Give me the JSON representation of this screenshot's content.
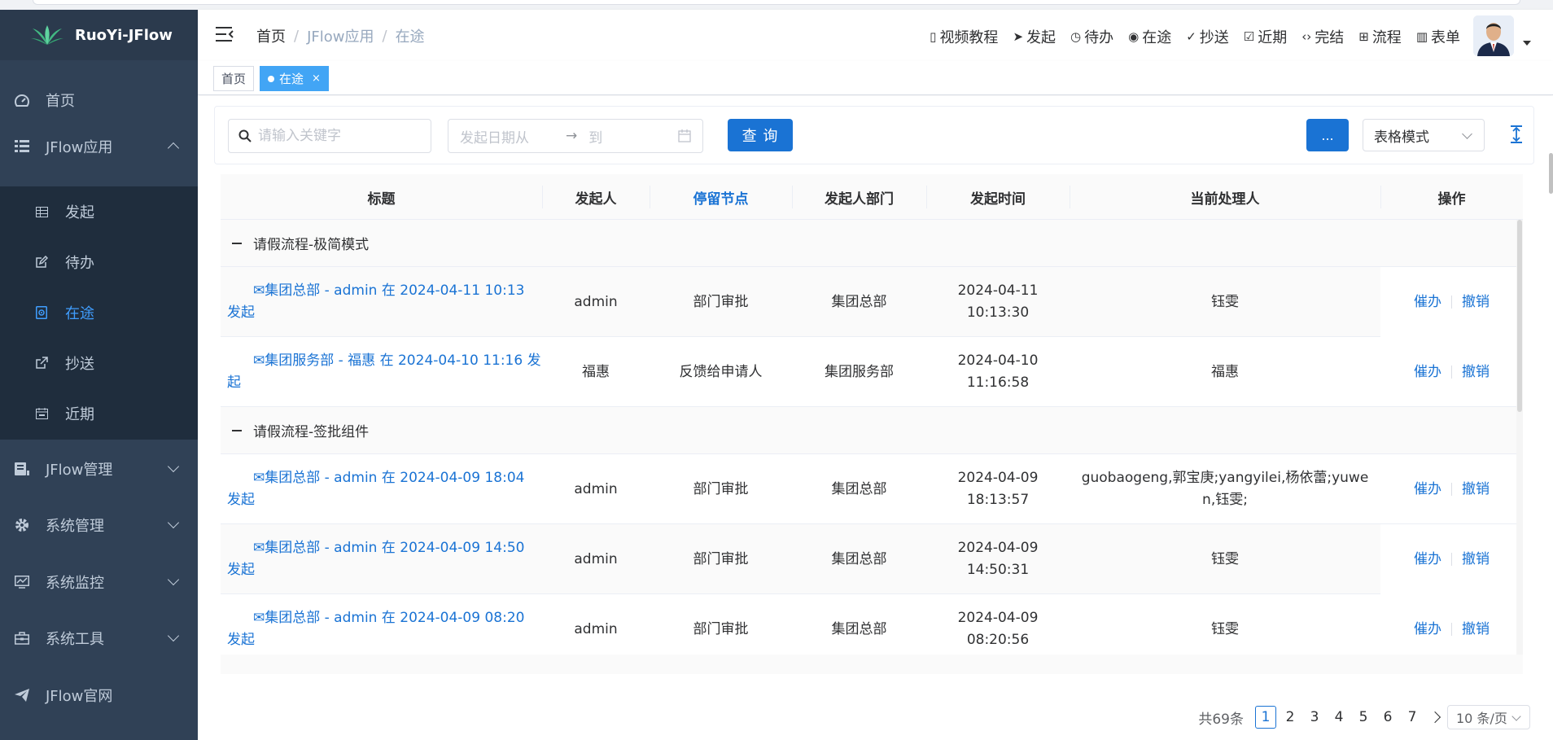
{
  "app": {
    "title": "RuoYi-JFlow"
  },
  "sidebar": {
    "items": [
      {
        "label": "首页",
        "icon": "dashboard-icon"
      },
      {
        "label": "JFlow应用",
        "icon": "tree-table-icon",
        "expanded": true
      },
      {
        "label": "JFlow管理",
        "icon": "monitor-icon"
      },
      {
        "label": "系统管理",
        "icon": "gear-icon"
      },
      {
        "label": "系统监控",
        "icon": "chart-icon"
      },
      {
        "label": "系统工具",
        "icon": "toolbox-icon"
      },
      {
        "label": "JFlow官网",
        "icon": "send-icon"
      }
    ],
    "submenu": [
      {
        "label": "发起",
        "icon": "grid-icon"
      },
      {
        "label": "待办",
        "icon": "edit-icon"
      },
      {
        "label": "在途",
        "icon": "target-icon",
        "active": true
      },
      {
        "label": "抄送",
        "icon": "external-link-icon"
      },
      {
        "label": "近期",
        "icon": "calendar-icon"
      }
    ]
  },
  "header": {
    "breadcrumb": [
      "首页",
      "JFlow应用",
      "在途"
    ],
    "nav": [
      {
        "label": "视频教程",
        "icon": "mobile-icon"
      },
      {
        "label": "发起",
        "icon": "send-icon"
      },
      {
        "label": "待办",
        "icon": "clock-icon"
      },
      {
        "label": "在途",
        "icon": "target-icon"
      },
      {
        "label": "抄送",
        "icon": "check-circle-icon"
      },
      {
        "label": "近期",
        "icon": "check-square-icon"
      },
      {
        "label": "完结",
        "icon": "code-icon"
      },
      {
        "label": "流程",
        "icon": "sitemap-icon"
      },
      {
        "label": "表单",
        "icon": "book-icon"
      }
    ]
  },
  "tags": [
    {
      "label": "首页",
      "active": false
    },
    {
      "label": "在途",
      "active": true,
      "close": "×"
    }
  ],
  "toolbar": {
    "search_placeholder": "请输入关键字",
    "date_from_placeholder": "发起日期从",
    "date_arrow": "→",
    "date_to_placeholder": "到",
    "query_label": "查 询",
    "more_label": "...",
    "mode_value": "表格模式"
  },
  "table": {
    "columns": [
      "标题",
      "发起人",
      "停留节点",
      "发起人部门",
      "发起时间",
      "当前处理人",
      "操作"
    ],
    "groups": [
      {
        "name": "请假流程-极简模式",
        "rows": [
          {
            "title": "✉集团总部 - admin 在 2024-04-11 10:13 发起",
            "starter": "admin",
            "node": "部门审批",
            "dept": "集团总部",
            "time_date": "2024-04-11",
            "time_clock": "10:13:30",
            "handler": "钰雯"
          },
          {
            "title": "✉集团服务部 - 福惠 在 2024-04-10 11:16 发起",
            "starter": "福惠",
            "node": "反馈给申请人",
            "dept": "集团服务部",
            "time_date": "2024-04-10",
            "time_clock": "11:16:58",
            "handler": "福惠"
          }
        ]
      },
      {
        "name": "请假流程-签批组件",
        "rows": [
          {
            "title": "✉集团总部 - admin 在 2024-04-09 18:04 发起",
            "starter": "admin",
            "node": "部门审批",
            "dept": "集团总部",
            "time_date": "2024-04-09",
            "time_clock": "18:13:57",
            "handler": "guobaogeng,郭宝庚;yangyilei,杨依蕾;yuwen,钰雯;"
          },
          {
            "title": "✉集团总部 - admin 在 2024-04-09 14:50 发起",
            "starter": "admin",
            "node": "部门审批",
            "dept": "集团总部",
            "time_date": "2024-04-09",
            "time_clock": "14:50:31",
            "handler": "钰雯"
          },
          {
            "title": "✉集团总部 - admin 在 2024-04-09 08:20 发起",
            "starter": "admin",
            "node": "部门审批",
            "dept": "集团总部",
            "time_date": "2024-04-09",
            "time_clock": "08:20:56",
            "handler": "钰雯"
          }
        ]
      }
    ],
    "actions": {
      "urge": "催办",
      "revoke": "撤销"
    }
  },
  "pagination": {
    "total": "共69条",
    "pages": [
      "1",
      "2",
      "3",
      "4",
      "5",
      "6",
      "7"
    ],
    "current": "1",
    "page_size": "10 条/页"
  },
  "colors": {
    "sidebar_bg": "#304156",
    "submenu_bg": "#1f2d3d",
    "accent": "#1a73d4",
    "tag_active": "#42a5f5"
  }
}
